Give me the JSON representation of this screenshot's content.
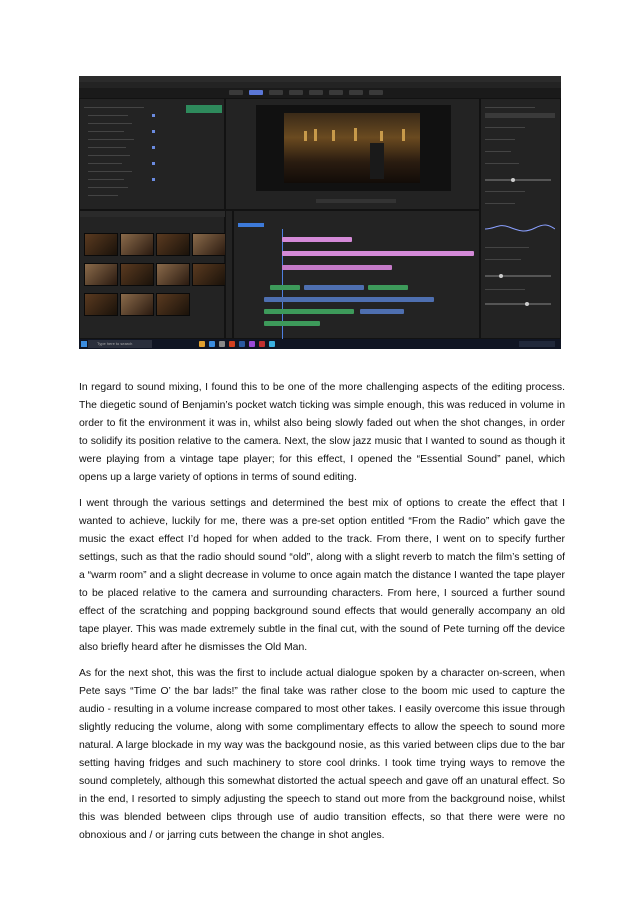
{
  "screenshot": {
    "taskbar": {
      "search_placeholder": "Type here to search"
    },
    "colors": {
      "accent": "#5b77d6",
      "timeline_pink": "#d48ad8",
      "timeline_green": "#3d9a5a",
      "timeline_blue": "#4e6fb0"
    }
  },
  "paragraphs": [
    "In regard to sound mixing, I found this to be one of the more challenging aspects of the editing process. The diegetic sound of Benjamin’s pocket watch ticking was simple enough, this was reduced in volume in order to fit the environment it was in, whilst also being slowly faded out when the shot changes, in order to solidify its position relative to the camera. Next, the slow jazz music that I wanted to sound as though it were playing from a vintage tape player; for this effect, I opened the “Essential Sound” panel, which opens up a large variety of options in terms of sound editing.",
    "I went through the various settings and determined the best mix of options to create the effect that I wanted to achieve, luckily for me, there was a pre-set option entitled “From the Radio” which gave the music the exact effect I’d hoped for when added to the track. From there, I went on to specify further settings, such as that the radio should sound “old”, along with a slight reverb to match the film’s setting of a “warm room” and a slight decrease in volume to once again match the distance I wanted the tape player to be placed relative to the camera and surrounding characters. From here, I sourced a further sound effect of the scratching and popping background sound effects that would generally accompany an old tape player. This was made extremely subtle in the final cut, with the sound of Pete turning off the device also briefly heard after he dismisses the Old Man.",
    "As for the next shot, this was the first to include actual dialogue spoken by a character on-screen, when Pete says “Time O’ the bar lads!” the final take was rather close to the boom mic used to capture the audio - resulting in a volume increase compared to most other takes. I easily overcome this issue through slightly reducing the volume, along with some complimentary effects to allow the speech to sound more natural. A large blockade in my way was the backgound nosie, as this varied between clips due to the bar setting having fridges and such machinery to store cool drinks. I took time trying ways to remove the sound completely, although this somewhat distorted the actual speech and gave off an unatural effect. So in the end, I resorted to simply adjusting the speech to stand out more from the background noise, whilst this was blended between clips through use of audio transition effects, so that there were were no obnoxious and / or jarring cuts between the change in shot angles."
  ]
}
